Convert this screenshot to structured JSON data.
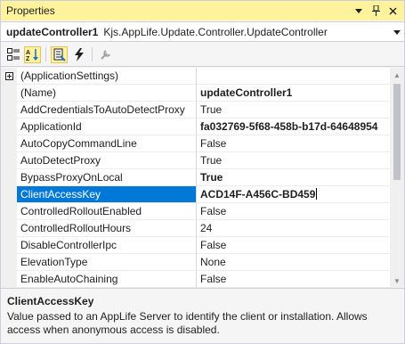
{
  "window": {
    "title": "Properties"
  },
  "title_controls": {
    "dropdown_icon": "chevron-down-icon",
    "pin_icon": "pin-icon",
    "close_icon": "close-icon"
  },
  "object_selector": {
    "name": "updateController1",
    "type": "Kjs.AppLife.Update.Controller.UpdateController"
  },
  "toolbar": {
    "buttons": [
      {
        "icon": "categorized-icon",
        "active": false
      },
      {
        "icon": "alphabetical-sort-icon",
        "active": true
      },
      {
        "icon": "properties-icon",
        "active": true
      },
      {
        "icon": "events-lightning-icon",
        "active": false
      },
      {
        "icon": "property-pages-wrench-icon",
        "active": false
      }
    ]
  },
  "properties": [
    {
      "name": "(ApplicationSettings)",
      "value": "",
      "expandable": true,
      "bold": false,
      "selected": false
    },
    {
      "name": "(Name)",
      "value": "updateController1",
      "expandable": false,
      "bold": true,
      "selected": false
    },
    {
      "name": "AddCredentialsToAutoDetectProxy",
      "value": "True",
      "expandable": false,
      "bold": false,
      "selected": false
    },
    {
      "name": "ApplicationId",
      "value": "fa032769-5f68-458b-b17d-64648954",
      "expandable": false,
      "bold": true,
      "selected": false
    },
    {
      "name": "AutoCopyCommandLine",
      "value": "False",
      "expandable": false,
      "bold": false,
      "selected": false
    },
    {
      "name": "AutoDetectProxy",
      "value": "True",
      "expandable": false,
      "bold": false,
      "selected": false
    },
    {
      "name": "BypassProxyOnLocal",
      "value": "True",
      "expandable": false,
      "bold": true,
      "selected": false
    },
    {
      "name": "ClientAccessKey",
      "value": "ACD14F-A456C-BD459",
      "expandable": false,
      "bold": true,
      "selected": true
    },
    {
      "name": "ControlledRolloutEnabled",
      "value": "False",
      "expandable": false,
      "bold": false,
      "selected": false
    },
    {
      "name": "ControlledRolloutHours",
      "value": "24",
      "expandable": false,
      "bold": false,
      "selected": false
    },
    {
      "name": "DisableControllerIpc",
      "value": "False",
      "expandable": false,
      "bold": false,
      "selected": false
    },
    {
      "name": "ElevationType",
      "value": "None",
      "expandable": false,
      "bold": false,
      "selected": false
    },
    {
      "name": "EnableAutoChaining",
      "value": "False",
      "expandable": false,
      "bold": false,
      "selected": false
    }
  ],
  "description": {
    "title": "ClientAccessKey",
    "text": "Value passed to an AppLife Server to identify the client or installation. Allows access when anonymous access is disabled."
  },
  "colors": {
    "title_bar": "#fff29d",
    "selection": "#0078d7",
    "active_toolbar_button": "#fff29d"
  }
}
